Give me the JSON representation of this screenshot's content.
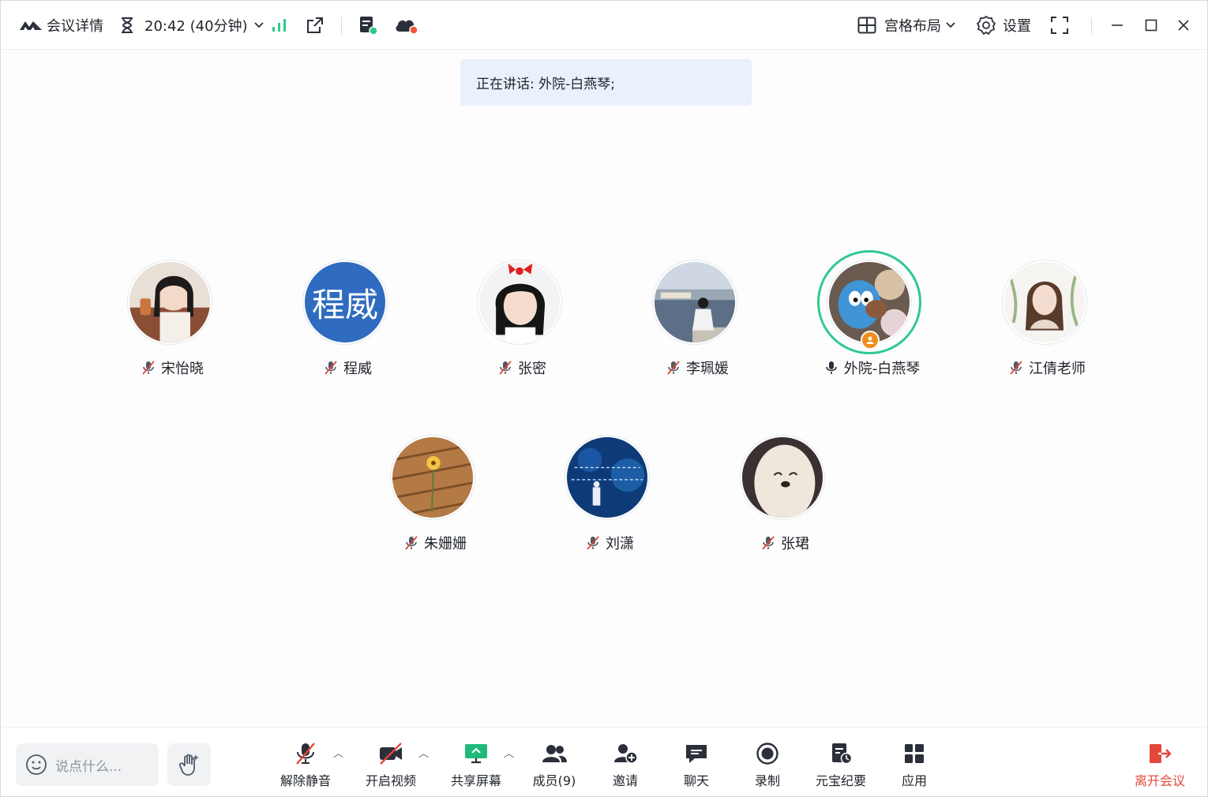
{
  "titlebar": {
    "meeting_details": "会议详情",
    "timer": "20:42 (40分钟)",
    "layout": "宫格布局",
    "settings": "设置"
  },
  "speaking": {
    "text": "正在讲话: 外院-白燕琴;"
  },
  "participants_row1": [
    {
      "name": "宋怡晓",
      "avatar": "photo-girl",
      "muted": true
    },
    {
      "name": "程威",
      "avatar_text": "程威",
      "muted": true
    },
    {
      "name": "张密",
      "avatar": "photo-child",
      "muted": true
    },
    {
      "name": "李珮媛",
      "avatar": "photo-lake",
      "muted": true
    },
    {
      "name": "外院-白燕琴",
      "avatar": "photo-plush",
      "muted": false,
      "speaking": true,
      "host": true
    },
    {
      "name": "江倩老师",
      "avatar": "photo-painting",
      "muted": true
    }
  ],
  "participants_row2": [
    {
      "name": "朱姗姗",
      "avatar": "photo-flower",
      "muted": true
    },
    {
      "name": "刘潇",
      "avatar": "photo-blue",
      "muted": true
    },
    {
      "name": "张珺",
      "avatar": "photo-dog",
      "muted": true
    }
  ],
  "toolbar": {
    "say_placeholder": "说点什么...",
    "unmute": "解除静音",
    "start_video": "开启视频",
    "share_screen": "共享屏幕",
    "members": "成员(9)",
    "invite": "邀请",
    "chat": "聊天",
    "record": "录制",
    "summary": "元宝纪要",
    "apps": "应用",
    "leave": "离开会议"
  },
  "colors": {
    "accent_green": "#2fc98e",
    "leave_red": "#e3473a",
    "banner_bg": "#eaf1fd",
    "avatar_blue": "#2f6cc0"
  }
}
